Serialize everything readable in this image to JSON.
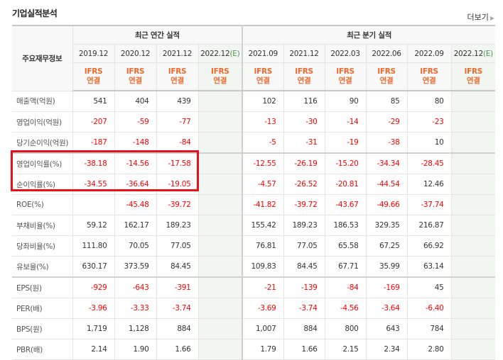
{
  "title": "기업실적분석",
  "more_label": "더보기",
  "header": {
    "row_label": "주요재무정보",
    "annual_group": "최근 연간 실적",
    "quarter_group": "최근 분기 실적",
    "ifrs": "IFRS",
    "consol": "연결",
    "est_mark": "(E)"
  },
  "periods": [
    {
      "label": "2019.12",
      "est": false
    },
    {
      "label": "2020.12",
      "est": false
    },
    {
      "label": "2021.12",
      "est": false
    },
    {
      "label": "2022.12",
      "est": true
    },
    {
      "label": "2021.09",
      "est": false
    },
    {
      "label": "2021.12",
      "est": false
    },
    {
      "label": "2022.03",
      "est": false
    },
    {
      "label": "2022.06",
      "est": false
    },
    {
      "label": "2022.09",
      "est": false
    },
    {
      "label": "2022.12",
      "est": true
    }
  ],
  "rows": [
    {
      "label": "매출액(억원)",
      "values": [
        "541",
        "404",
        "439",
        "",
        "102",
        "116",
        "90",
        "85",
        "80",
        ""
      ]
    },
    {
      "label": "영업이익(억원)",
      "values": [
        "-207",
        "-59",
        "-77",
        "",
        "-13",
        "-30",
        "-14",
        "-29",
        "-23",
        ""
      ]
    },
    {
      "label": "당기순이익(억원)",
      "values": [
        "-187",
        "-148",
        "-84",
        "",
        "-5",
        "-31",
        "-19",
        "-38",
        "10",
        ""
      ]
    },
    {
      "label": "영업이익률(%)",
      "values": [
        "-38.18",
        "-14.56",
        "-17.58",
        "",
        "-12.55",
        "-26.19",
        "-15.20",
        "-34.34",
        "-28.45",
        ""
      ]
    },
    {
      "label": "순이익률(%)",
      "values": [
        "-34.55",
        "-36.64",
        "-19.05",
        "",
        "-4.57",
        "-26.52",
        "-20.81",
        "-44.54",
        "12.46",
        ""
      ]
    },
    {
      "label": "ROE(%)",
      "values": [
        "",
        "-45.48",
        "-39.72",
        "",
        "-41.82",
        "-39.72",
        "-43.67",
        "-49.66",
        "-37.74",
        ""
      ]
    },
    {
      "label": "부채비율(%)",
      "values": [
        "59.12",
        "162.17",
        "189.23",
        "",
        "155.42",
        "189.23",
        "186.53",
        "329.35",
        "216.87",
        ""
      ]
    },
    {
      "label": "당좌비율(%)",
      "values": [
        "111.80",
        "70.05",
        "77.05",
        "",
        "76.81",
        "77.05",
        "65.58",
        "67.25",
        "66.92",
        ""
      ]
    },
    {
      "label": "유보율(%)",
      "values": [
        "630.17",
        "373.59",
        "84.45",
        "",
        "109.83",
        "84.45",
        "67.71",
        "35.99",
        "63.14",
        ""
      ]
    },
    {
      "label": "EPS(원)",
      "values": [
        "-929",
        "-643",
        "-391",
        "",
        "-21",
        "-139",
        "-84",
        "-169",
        "45",
        ""
      ]
    },
    {
      "label": "PER(배)",
      "values": [
        "-3.96",
        "-3.33",
        "-3.74",
        "",
        "-3.69",
        "-3.74",
        "-4.56",
        "-3.64",
        "-6.40",
        ""
      ]
    },
    {
      "label": "BPS(원)",
      "values": [
        "1,719",
        "1,128",
        "884",
        "",
        "1,007",
        "884",
        "800",
        "643",
        "784",
        ""
      ]
    },
    {
      "label": "PBR(배)",
      "values": [
        "2.14",
        "1.90",
        "1.66",
        "",
        "1.79",
        "1.66",
        "2.15",
        "2.34",
        "2.80",
        ""
      ]
    }
  ],
  "colors": {
    "negative": "#ff0000",
    "ifrs": "#ee6a2c",
    "highlight_box": "#e8101a",
    "estimate_bg": "#f1f6f1"
  }
}
